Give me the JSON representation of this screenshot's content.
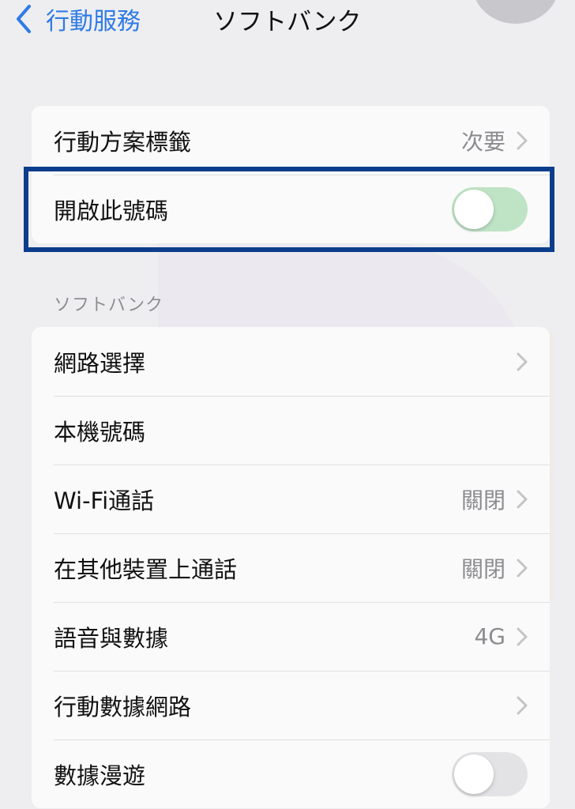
{
  "navbar": {
    "back_label": "行動服務",
    "title": "ソフトバンク"
  },
  "group1": {
    "rows": [
      {
        "label": "行動方案標籤",
        "value": "次要"
      },
      {
        "label": "開啟此號碼",
        "toggle": "on"
      }
    ]
  },
  "section": {
    "header": "ソフトバンク"
  },
  "group2": {
    "rows": [
      {
        "label": "網路選擇",
        "value": ""
      },
      {
        "label": "本機號碼"
      },
      {
        "label": "Wi-Fi通話",
        "value": "關閉"
      },
      {
        "label": "在其他裝置上通話",
        "value": "關閉"
      },
      {
        "label": "語音與數據",
        "value": "4G"
      },
      {
        "label": "行動數據網路",
        "value": ""
      },
      {
        "label": "數據漫遊",
        "toggle": "off"
      }
    ]
  },
  "colors": {
    "accent": "#2f7be6",
    "highlight_border": "#0c3d8c",
    "toggle_green": "#bfe3c5",
    "background": "#eeeef0"
  }
}
